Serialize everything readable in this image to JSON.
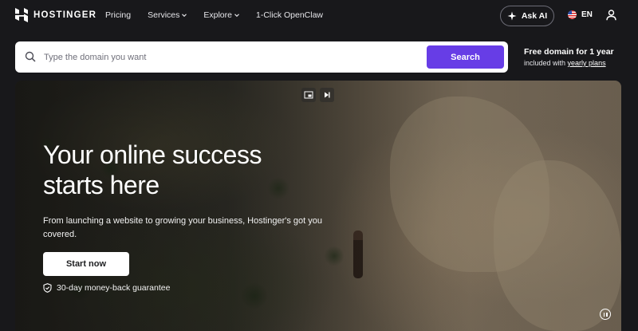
{
  "nav": {
    "brand": "HOSTINGER",
    "links": [
      {
        "label": "Pricing",
        "has_dropdown": false
      },
      {
        "label": "Services",
        "has_dropdown": true
      },
      {
        "label": "Explore",
        "has_dropdown": true
      },
      {
        "label": "1-Click OpenClaw",
        "has_dropdown": false
      }
    ],
    "ask_ai_label": "Ask AI",
    "language": "EN",
    "icons": {
      "logo": "hostinger-logo-icon",
      "ask_ai": "sparkle-icon",
      "language": "us-flag-icon",
      "account": "user-icon",
      "dropdown": "chevron-down-icon"
    }
  },
  "search": {
    "placeholder": "Type the domain you want",
    "value": "",
    "button_label": "Search",
    "icon": "search-icon"
  },
  "promo": {
    "title": "Free domain for 1 year",
    "subtitle_prefix": "included with ",
    "subtitle_link": "yearly plans"
  },
  "hero": {
    "title_line1": "Your online success",
    "title_line2": "starts here",
    "description": "From launching a website to growing your business, Hostinger's got you covered.",
    "cta_label": "Start now",
    "guarantee": "30-day money-back guarantee",
    "icons": {
      "guarantee": "shield-check-icon",
      "pause": "pause-icon",
      "media_a": "picture-in-picture-icon",
      "media_b": "skip-forward-icon"
    }
  },
  "colors": {
    "background": "#18181b",
    "accent": "#673de6",
    "text": "#ffffff"
  }
}
